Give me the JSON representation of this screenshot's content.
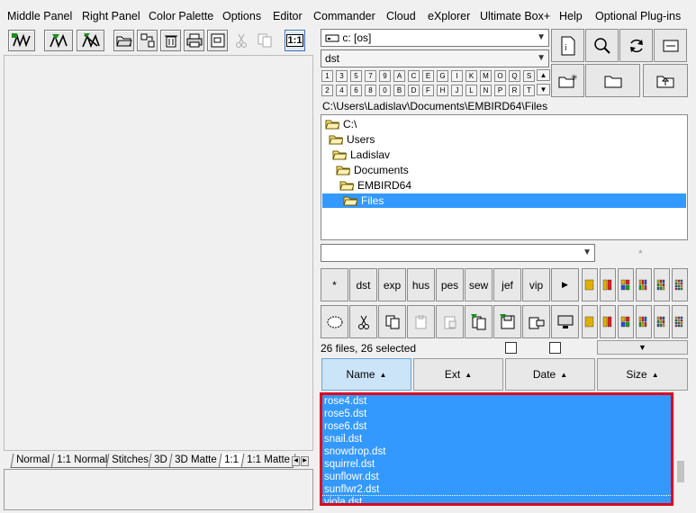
{
  "menu": [
    "Middle Panel",
    "Right Panel",
    "Color Palette",
    "Options",
    "Editor",
    "Commander",
    "Cloud",
    "eXplorer",
    "Ultimate Box+",
    "Help",
    "Optional Plug-ins"
  ],
  "toolbar": {
    "zoom_label": "1:1"
  },
  "left_tabs": [
    "Normal",
    "1:1 Normal",
    "Stitches",
    "3D",
    "3D Matte",
    "1:1",
    "1:1 Matte"
  ],
  "drive_combo": "c: [os]",
  "filter_combo": "dst",
  "letters_row1": [
    "1",
    "3",
    "5",
    "7",
    "9",
    "A",
    "C",
    "E",
    "G",
    "I",
    "K",
    "M",
    "O",
    "Q",
    "S"
  ],
  "letters_row2": [
    "2",
    "4",
    "6",
    "8",
    "0",
    "B",
    "D",
    "F",
    "H",
    "J",
    "L",
    "N",
    "P",
    "R",
    "T"
  ],
  "path": "C:\\Users\\Ladislav\\Documents\\EMBIRD64\\Files",
  "tree": [
    {
      "label": "C:\\",
      "indent": 0
    },
    {
      "label": "Users",
      "indent": 1
    },
    {
      "label": "Ladislav",
      "indent": 2
    },
    {
      "label": "Documents",
      "indent": 3
    },
    {
      "label": "EMBIRD64",
      "indent": 4
    },
    {
      "label": "Files",
      "indent": 5,
      "selected": true
    }
  ],
  "mask_combo": "",
  "asterisk_label": "*",
  "ext_buttons": [
    "*",
    "dst",
    "exp",
    "hus",
    "pes",
    "sew",
    "jef",
    "vip"
  ],
  "status_text": "26 files, 26 selected",
  "headers": [
    "Name",
    "Ext",
    "Date",
    "Size"
  ],
  "files": [
    "rose4.dst",
    "rose5.dst",
    "rose6.dst",
    "snail.dst",
    "snowdrop.dst",
    "squirrel.dst",
    "sunflowr.dst",
    "sunflwr2.dst",
    "viola.dst"
  ],
  "colors": {
    "selection": "#3399ff",
    "highlight_border": "#e0001a",
    "tree_selected": "#3399ff"
  }
}
